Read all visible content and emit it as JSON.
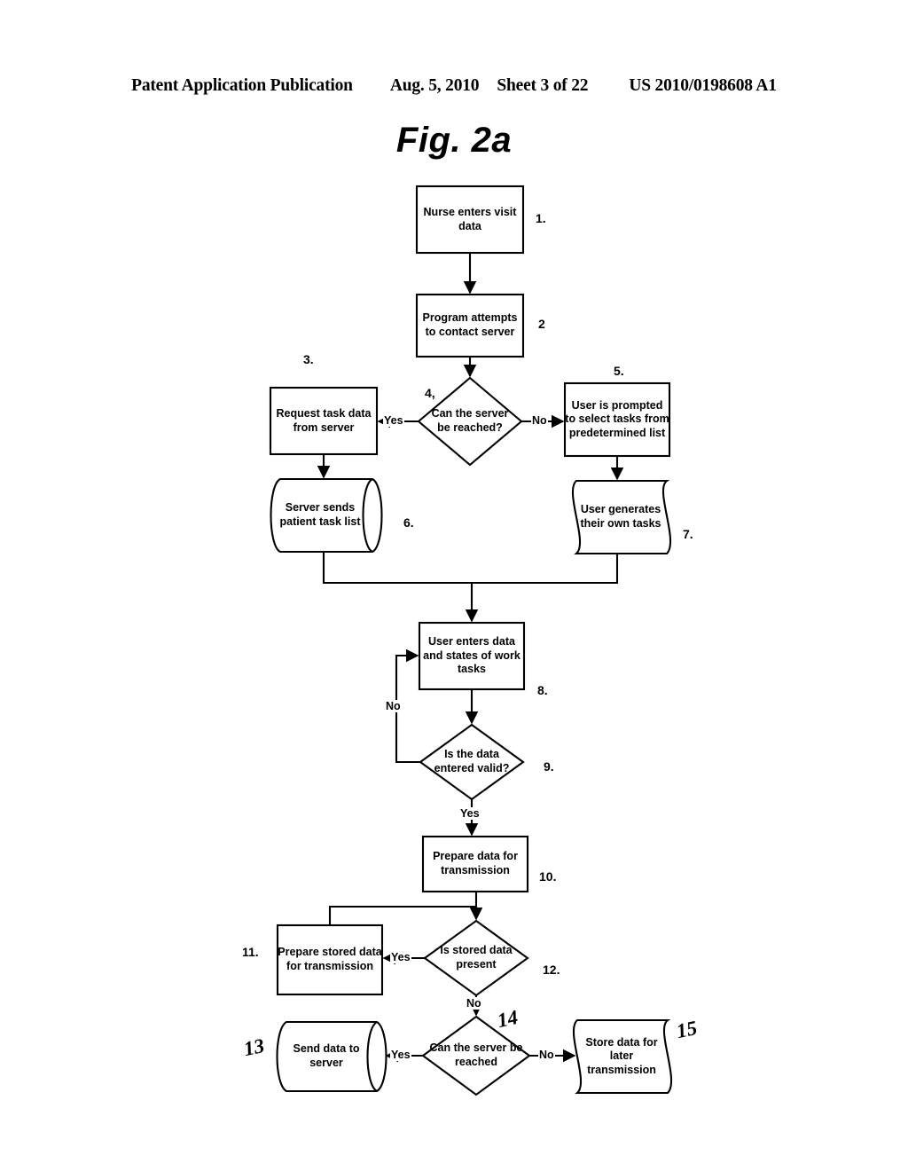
{
  "header": {
    "publication": "Patent Application Publication",
    "date": "Aug. 5, 2010",
    "sheet": "Sheet 3 of 22",
    "patent_number": "US 2010/0198608 A1"
  },
  "figure": {
    "title": "Fig. 2a"
  },
  "chart_data": {
    "type": "diagram",
    "diagram_type": "flowchart",
    "title": "Fig. 2a",
    "orientation": "top-to-bottom",
    "nodes": [
      {
        "id": "n1",
        "step": "1.",
        "shape": "process",
        "text": "Nurse enters visit data"
      },
      {
        "id": "n2",
        "step": "2",
        "shape": "process",
        "text": "Program attempts to contact server"
      },
      {
        "id": "n3",
        "step": "3.",
        "shape": "process",
        "text": "Request task data from server"
      },
      {
        "id": "n4",
        "step": "4,",
        "shape": "decision",
        "text": "Can the server be reached?"
      },
      {
        "id": "n5",
        "step": "5.",
        "shape": "process",
        "text": "User is prompted to select tasks from predetermined list"
      },
      {
        "id": "n6",
        "step": "6.",
        "shape": "cylinder",
        "text": "Server sends patient task list"
      },
      {
        "id": "n7",
        "step": "7.",
        "shape": "document",
        "text": "User generates their own tasks"
      },
      {
        "id": "n8",
        "step": "8.",
        "shape": "process",
        "text": "User enters data and states of work tasks"
      },
      {
        "id": "n9",
        "step": "9.",
        "shape": "decision",
        "text": "Is the data entered valid?"
      },
      {
        "id": "n10",
        "step": "10.",
        "shape": "process",
        "text": "Prepare data for transmission"
      },
      {
        "id": "n11",
        "step": "11.",
        "shape": "process",
        "text": "Prepare stored data for transmission"
      },
      {
        "id": "n12",
        "step": "12.",
        "shape": "decision",
        "text": "Is stored data present"
      },
      {
        "id": "n13",
        "step": "13",
        "shape": "cylinder",
        "text": "Send data to server",
        "step_style": "handwritten"
      },
      {
        "id": "n14",
        "step": "14",
        "shape": "decision",
        "text": "Can the server be reached",
        "step_style": "handwritten"
      },
      {
        "id": "n15",
        "step": "15",
        "shape": "document",
        "text": "Store data for later transmission",
        "step_style": "handwritten"
      }
    ],
    "edges": [
      {
        "from": "n1",
        "to": "n2",
        "label": ""
      },
      {
        "from": "n2",
        "to": "n4",
        "label": ""
      },
      {
        "from": "n4",
        "to": "n3",
        "label": "Yes"
      },
      {
        "from": "n4",
        "to": "n5",
        "label": "No"
      },
      {
        "from": "n3",
        "to": "n6",
        "label": ""
      },
      {
        "from": "n5",
        "to": "n7",
        "label": ""
      },
      {
        "from": "n6",
        "to": "n8",
        "label": ""
      },
      {
        "from": "n7",
        "to": "n8",
        "label": ""
      },
      {
        "from": "n8",
        "to": "n9",
        "label": ""
      },
      {
        "from": "n9",
        "to": "n8",
        "label": "No"
      },
      {
        "from": "n9",
        "to": "n10",
        "label": "Yes"
      },
      {
        "from": "n10",
        "to": "n12",
        "label": ""
      },
      {
        "from": "n12",
        "to": "n11",
        "label": "Yes"
      },
      {
        "from": "n11",
        "to": "n12",
        "label": ""
      },
      {
        "from": "n12",
        "to": "n14",
        "label": "No"
      },
      {
        "from": "n14",
        "to": "n13",
        "label": "Yes"
      },
      {
        "from": "n14",
        "to": "n15",
        "label": "No"
      }
    ]
  },
  "colors": {
    "ink": "#000000",
    "paper": "#ffffff"
  }
}
